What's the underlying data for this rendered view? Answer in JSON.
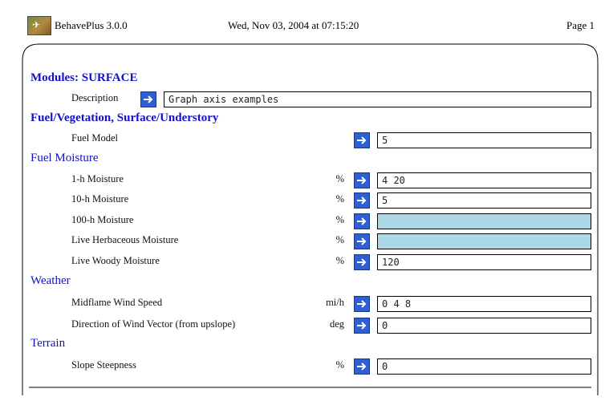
{
  "header": {
    "app_title": "BehavePlus 3.0.0",
    "datetime": "Wed, Nov 03, 2004 at 07:15:20",
    "page_label": "Page 1"
  },
  "modules": {
    "title": "Modules: SURFACE",
    "description_label": "Description",
    "description_value": "Graph axis examples"
  },
  "sections": {
    "fuel_vegetation": "Fuel/Vegetation, Surface/Understory",
    "fuel_moisture": "Fuel Moisture",
    "weather": "Weather",
    "terrain": "Terrain"
  },
  "fields": {
    "fuel_model": {
      "label": "Fuel Model",
      "unit": "",
      "value": "5"
    },
    "moist_1h": {
      "label": "1-h Moisture",
      "unit": "%",
      "value": "4 20"
    },
    "moist_10h": {
      "label": "10-h Moisture",
      "unit": "%",
      "value": "5"
    },
    "moist_100h": {
      "label": "100-h Moisture",
      "unit": "%",
      "value": ""
    },
    "moist_herb": {
      "label": "Live Herbaceous Moisture",
      "unit": "%",
      "value": ""
    },
    "moist_woody": {
      "label": "Live Woody Moisture",
      "unit": "%",
      "value": "120"
    },
    "wind_speed": {
      "label": "Midflame Wind Speed",
      "unit": "mi/h",
      "value": "0 4 8"
    },
    "wind_dir": {
      "label": "Direction of Wind Vector (from upslope)",
      "unit": "deg",
      "value": "0"
    },
    "slope": {
      "label": "Slope Steepness",
      "unit": "%",
      "value": "0"
    }
  },
  "colors": {
    "section_text": "#1111cc",
    "arrow_button": "#2f5fd0",
    "empty_field": "#add8e6"
  },
  "icons": {
    "logo": "behaveplus-logo-icon",
    "arrow": "arrow-right-icon"
  }
}
